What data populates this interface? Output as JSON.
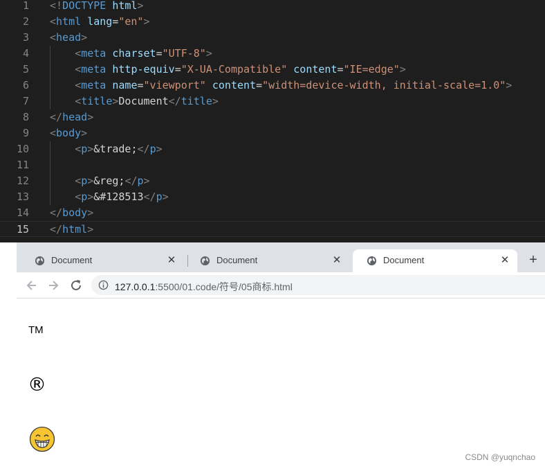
{
  "editor": {
    "lines": [
      {
        "n": "1",
        "indent": 0,
        "tokens": [
          [
            "tag",
            "<!"
          ],
          [
            "name",
            "DOCTYPE"
          ],
          [
            "text",
            " "
          ],
          [
            "attr",
            "html"
          ],
          [
            "tag",
            ">"
          ]
        ]
      },
      {
        "n": "2",
        "indent": 0,
        "tokens": [
          [
            "tag",
            "<"
          ],
          [
            "name",
            "html"
          ],
          [
            "text",
            " "
          ],
          [
            "attr",
            "lang"
          ],
          [
            "text",
            "="
          ],
          [
            "str",
            "\"en\""
          ],
          [
            "tag",
            ">"
          ]
        ]
      },
      {
        "n": "3",
        "indent": 0,
        "tokens": [
          [
            "tag",
            "<"
          ],
          [
            "name",
            "head"
          ],
          [
            "tag",
            ">"
          ]
        ]
      },
      {
        "n": "4",
        "indent": 1,
        "tokens": [
          [
            "tag",
            "<"
          ],
          [
            "name",
            "meta"
          ],
          [
            "text",
            " "
          ],
          [
            "attr",
            "charset"
          ],
          [
            "text",
            "="
          ],
          [
            "str",
            "\"UTF-8\""
          ],
          [
            "tag",
            ">"
          ]
        ]
      },
      {
        "n": "5",
        "indent": 1,
        "tokens": [
          [
            "tag",
            "<"
          ],
          [
            "name",
            "meta"
          ],
          [
            "text",
            " "
          ],
          [
            "attr",
            "http-equiv"
          ],
          [
            "text",
            "="
          ],
          [
            "str",
            "\"X-UA-Compatible\""
          ],
          [
            "text",
            " "
          ],
          [
            "attr",
            "content"
          ],
          [
            "text",
            "="
          ],
          [
            "str",
            "\"IE=edge\""
          ],
          [
            "tag",
            ">"
          ]
        ]
      },
      {
        "n": "6",
        "indent": 1,
        "tokens": [
          [
            "tag",
            "<"
          ],
          [
            "name",
            "meta"
          ],
          [
            "text",
            " "
          ],
          [
            "attr",
            "name"
          ],
          [
            "text",
            "="
          ],
          [
            "str",
            "\"viewport\""
          ],
          [
            "text",
            " "
          ],
          [
            "attr",
            "content"
          ],
          [
            "text",
            "="
          ],
          [
            "str",
            "\"width=device-width, initial-scale=1.0\""
          ],
          [
            "tag",
            ">"
          ]
        ]
      },
      {
        "n": "7",
        "indent": 1,
        "tokens": [
          [
            "tag",
            "<"
          ],
          [
            "name",
            "title"
          ],
          [
            "tag",
            ">"
          ],
          [
            "text",
            "Document"
          ],
          [
            "tag",
            "</"
          ],
          [
            "name",
            "title"
          ],
          [
            "tag",
            ">"
          ]
        ]
      },
      {
        "n": "8",
        "indent": 0,
        "tokens": [
          [
            "tag",
            "</"
          ],
          [
            "name",
            "head"
          ],
          [
            "tag",
            ">"
          ]
        ]
      },
      {
        "n": "9",
        "indent": 0,
        "tokens": [
          [
            "tag",
            "<"
          ],
          [
            "name",
            "body"
          ],
          [
            "tag",
            ">"
          ]
        ]
      },
      {
        "n": "10",
        "indent": 1,
        "tokens": [
          [
            "tag",
            "<"
          ],
          [
            "name",
            "p"
          ],
          [
            "tag",
            ">"
          ],
          [
            "text",
            "&trade;"
          ],
          [
            "tag",
            "</"
          ],
          [
            "name",
            "p"
          ],
          [
            "tag",
            ">"
          ]
        ]
      },
      {
        "n": "11",
        "indent": 1,
        "tokens": []
      },
      {
        "n": "12",
        "indent": 1,
        "tokens": [
          [
            "tag",
            "<"
          ],
          [
            "name",
            "p"
          ],
          [
            "tag",
            ">"
          ],
          [
            "text",
            "&reg;"
          ],
          [
            "tag",
            "</"
          ],
          [
            "name",
            "p"
          ],
          [
            "tag",
            ">"
          ]
        ]
      },
      {
        "n": "13",
        "indent": 1,
        "tokens": [
          [
            "tag",
            "<"
          ],
          [
            "name",
            "p"
          ],
          [
            "tag",
            ">"
          ],
          [
            "text",
            "&#128513"
          ],
          [
            "tag",
            "</"
          ],
          [
            "name",
            "p"
          ],
          [
            "tag",
            ">"
          ]
        ]
      },
      {
        "n": "14",
        "indent": 0,
        "tokens": [
          [
            "tag",
            "</"
          ],
          [
            "name",
            "body"
          ],
          [
            "tag",
            ">"
          ]
        ]
      },
      {
        "n": "15",
        "indent": 0,
        "tokens": [
          [
            "tag",
            "</"
          ],
          [
            "name",
            "html"
          ],
          [
            "tag",
            ">"
          ]
        ]
      }
    ],
    "active_line": "15"
  },
  "browser": {
    "tabs": [
      {
        "title": "Document",
        "close": "✕",
        "active": false
      },
      {
        "title": "Document",
        "close": "✕",
        "active": false
      },
      {
        "title": "Document",
        "close": "✕",
        "active": true
      }
    ],
    "new_tab": "+",
    "url_host": "127.0.0.1",
    "url_path": ":5500/01.code/符号/05商标.html",
    "page": {
      "trade": "TM",
      "reg": "®",
      "emoji_icon": "grinning-face-with-smiling-eyes-emoji"
    }
  },
  "watermark": "CSDN @yuqnchao",
  "colors": {
    "editor_bg": "#1e1e1e",
    "tag": "#808080",
    "name": "#569cd6",
    "attr": "#9cdcfe",
    "str": "#ce9178",
    "text": "#d4d4d4",
    "tabstrip_bg": "#dee1e6"
  }
}
